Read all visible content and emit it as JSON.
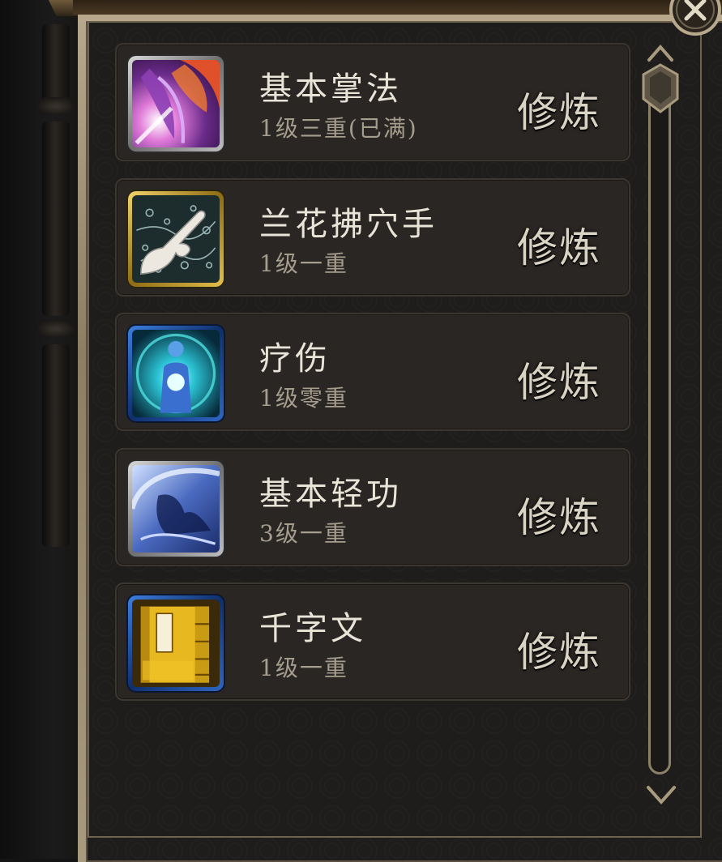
{
  "skills": [
    {
      "name": "基本掌法",
      "level": "1级三重(已满)",
      "button": "修炼",
      "frame": "silver",
      "icon": "palm-strike-icon"
    },
    {
      "name": "兰花拂穴手",
      "level": "1级一重",
      "button": "修炼",
      "frame": "gold",
      "icon": "orchid-finger-icon"
    },
    {
      "name": "疗伤",
      "level": "1级零重",
      "button": "修炼",
      "frame": "blue",
      "icon": "healing-icon"
    },
    {
      "name": "基本轻功",
      "level": "3级一重",
      "button": "修炼",
      "frame": "silver",
      "icon": "lightness-skill-icon"
    },
    {
      "name": "千字文",
      "level": "1级一重",
      "button": "修炼",
      "frame": "blue",
      "icon": "book-icon"
    }
  ],
  "colors": {
    "name_text": "#e9e4d8",
    "level_text": "#a59e8f",
    "button_text": "#d9d3c3",
    "frame_gold": "#b8a98d",
    "row_bg": "#2a2623"
  }
}
